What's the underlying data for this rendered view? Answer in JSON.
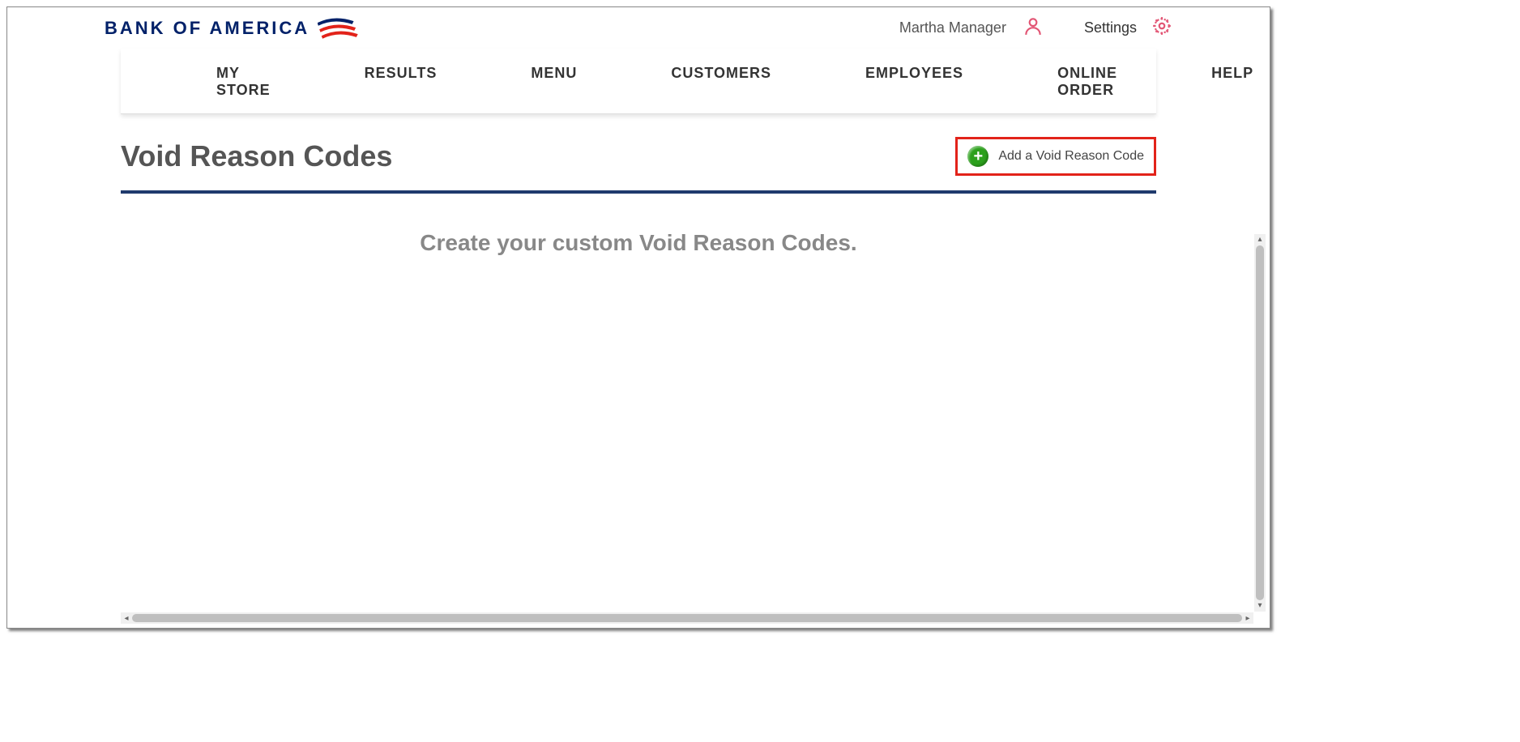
{
  "logo": {
    "text": "BANK OF AMERICA"
  },
  "header": {
    "user_name": "Martha Manager",
    "settings_label": "Settings"
  },
  "nav": {
    "items": [
      "MY STORE",
      "RESULTS",
      "MENU",
      "CUSTOMERS",
      "EMPLOYEES",
      "ONLINE ORDER",
      "HELP"
    ]
  },
  "page": {
    "title": "Void Reason Codes",
    "add_label": "Add a Void Reason Code",
    "subtitle": "Create your custom Void Reason Codes."
  },
  "icons": {
    "plus_glyph": "+"
  }
}
